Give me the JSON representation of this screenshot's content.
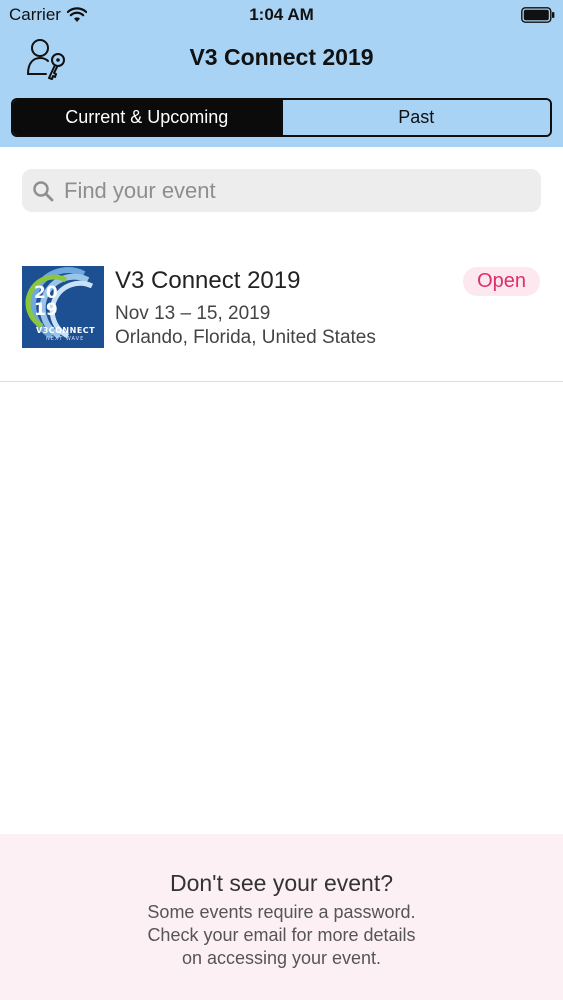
{
  "status_bar": {
    "carrier": "Carrier",
    "time": "1:04 AM"
  },
  "nav": {
    "title": "V3 Connect 2019",
    "profile_icon": "user-key-icon"
  },
  "tabs": [
    {
      "label": "Current & Upcoming",
      "active": true
    },
    {
      "label": "Past",
      "active": false
    }
  ],
  "search": {
    "placeholder": "Find your event",
    "value": ""
  },
  "events": [
    {
      "title": "V3 Connect 2019",
      "date": "Nov 13 – 15, 2019",
      "location": "Orlando, Florida, United States",
      "status": "Open",
      "thumb_year_top": "20",
      "thumb_year_bottom": "19",
      "thumb_brand": "V3CONNECT",
      "thumb_sub": "NEXT WAVE"
    }
  ],
  "footer": {
    "title": "Don't see your event?",
    "lines": [
      "Some events require a password.",
      "Check your email for more details",
      "on accessing your event."
    ]
  },
  "colors": {
    "header_bg": "#a9d3f4",
    "badge_text": "#de2e6b",
    "badge_bg": "#fde8ef",
    "footer_bg": "#fdf0f4"
  }
}
